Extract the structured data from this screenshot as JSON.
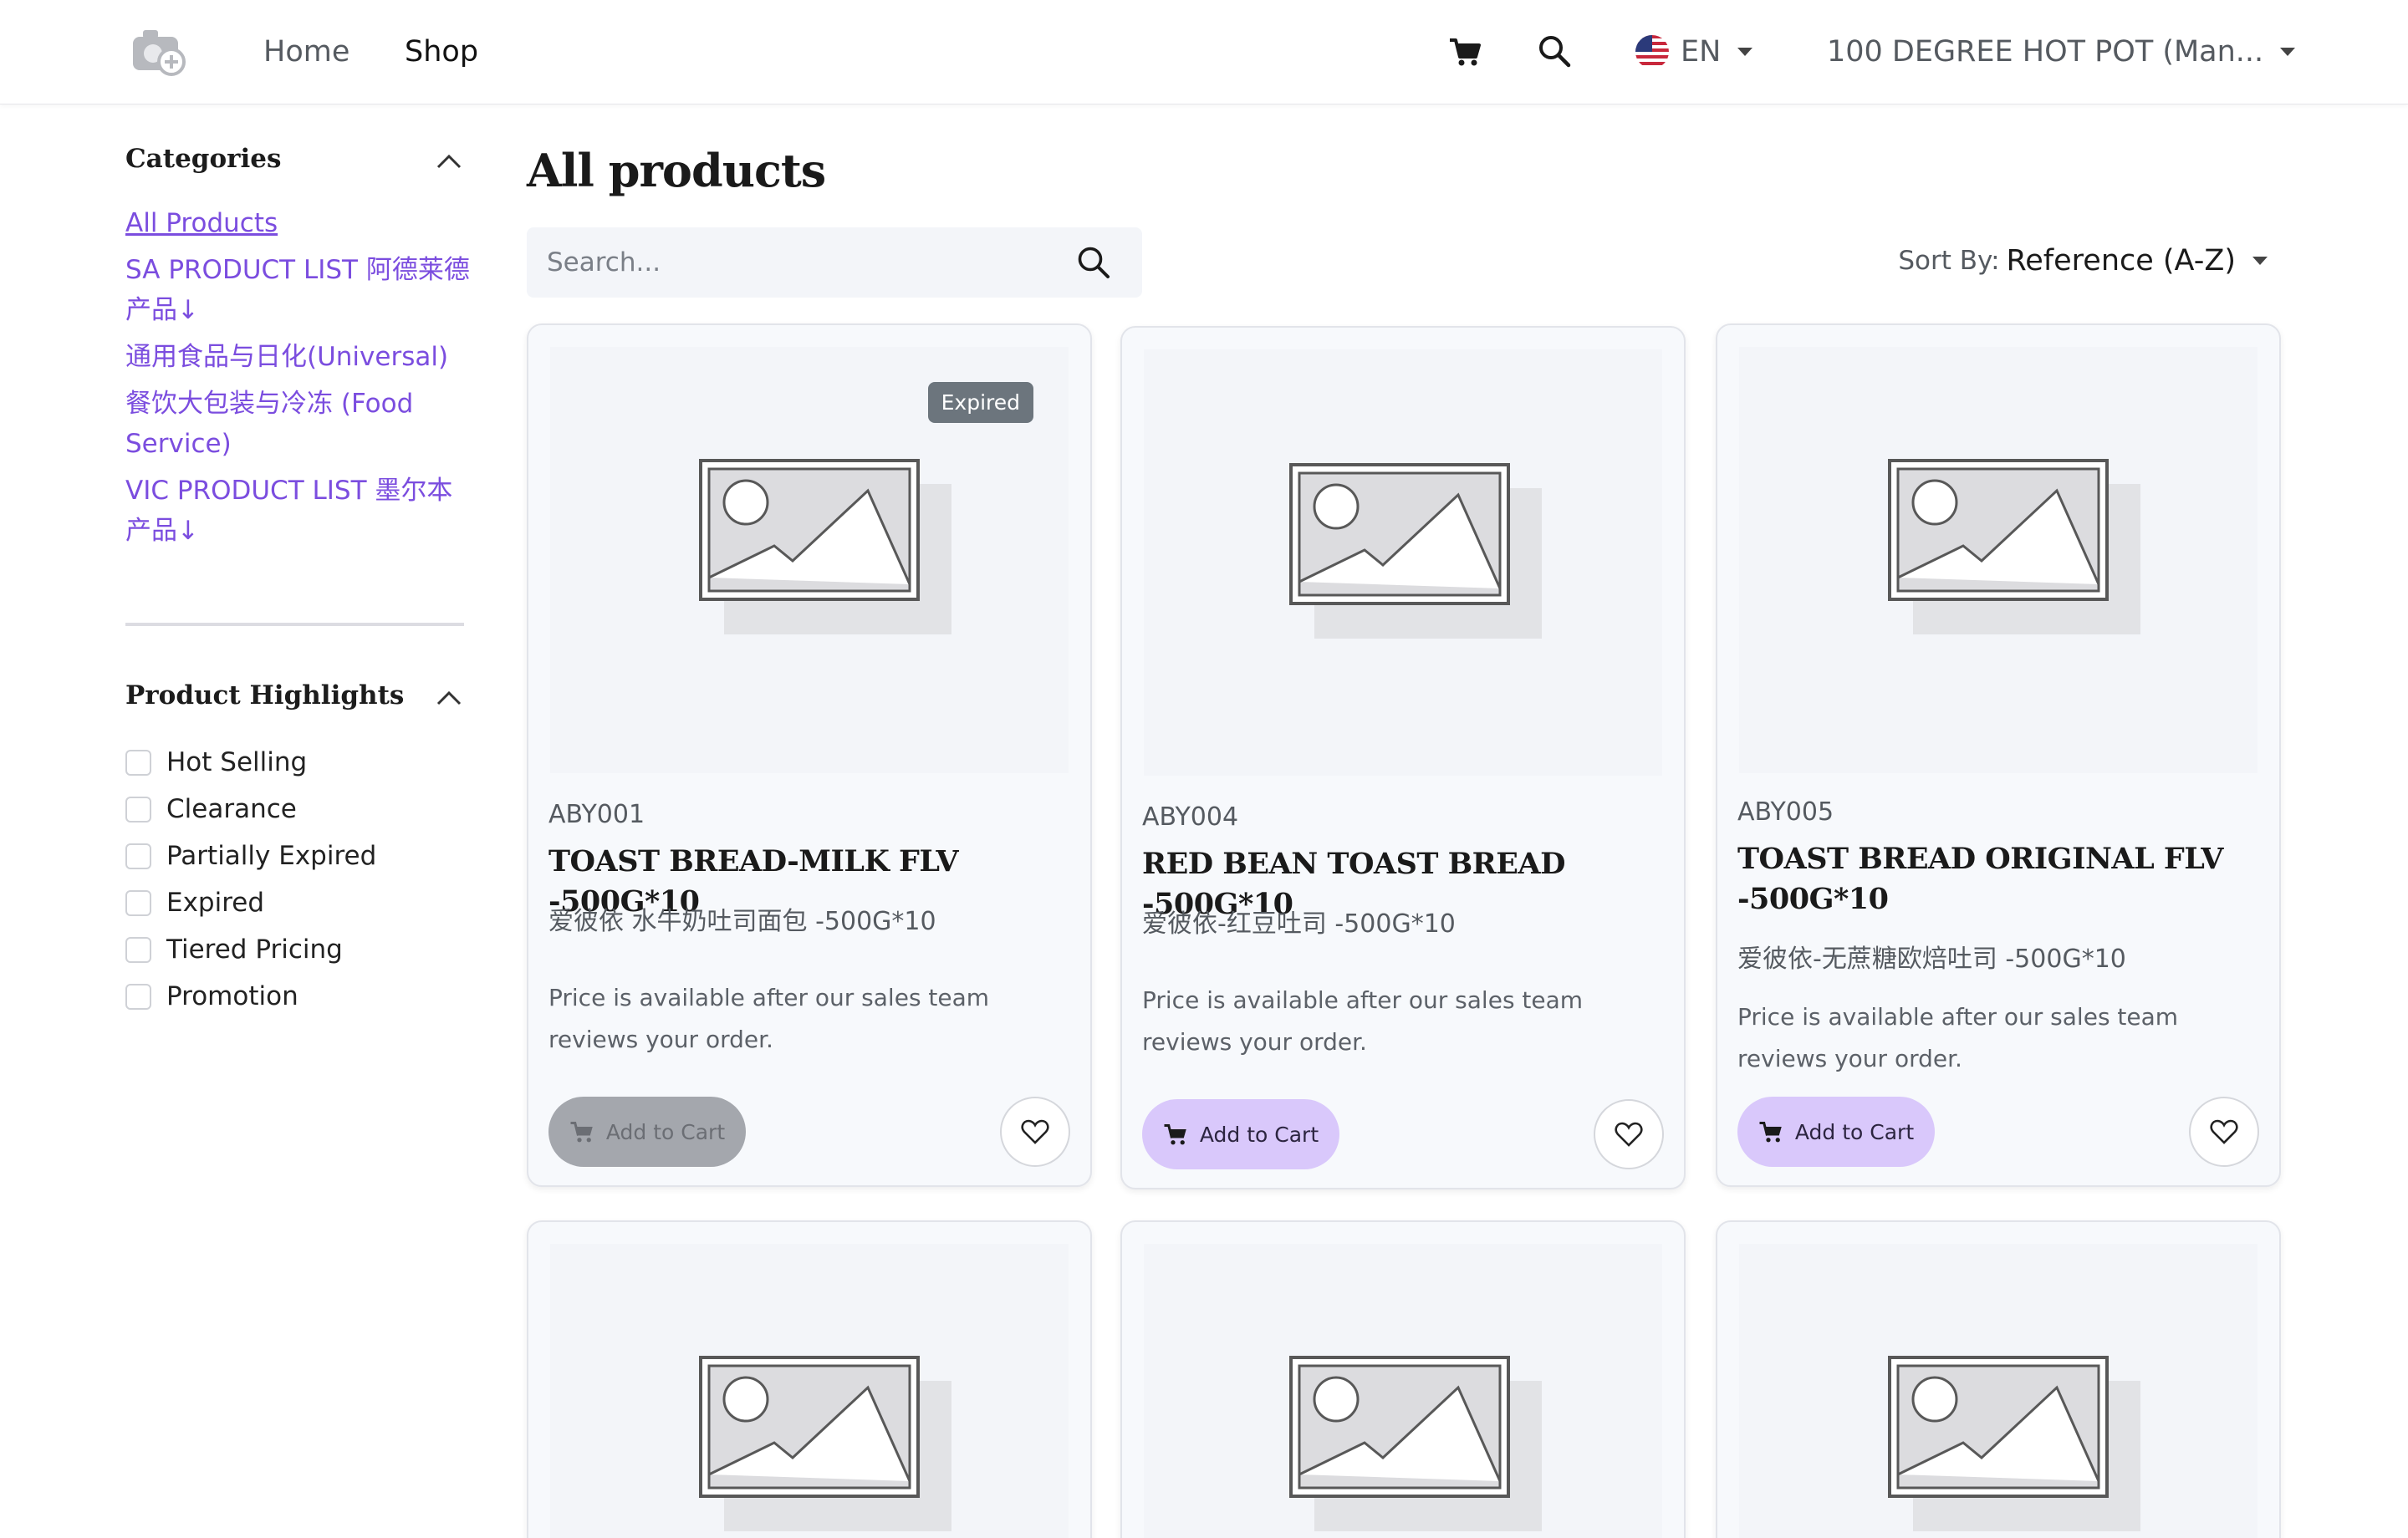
{
  "header": {
    "nav": [
      {
        "label": "Home"
      },
      {
        "label": "Shop"
      }
    ],
    "language": {
      "code": "EN",
      "flag": "us-flag"
    },
    "account": {
      "label": "100 DEGREE HOT POT (Man..."
    },
    "icons": {
      "logo": "camera-plus-icon",
      "cart": "cart-icon",
      "search": "search-icon"
    }
  },
  "sidebar": {
    "categories_title": "Categories",
    "categories": [
      {
        "label": "All Products",
        "active": true
      },
      {
        "label": "SA PRODUCT LIST 阿德莱德产品↓"
      },
      {
        "label": "通用食品与日化(Universal)"
      },
      {
        "label": "餐饮大包装与冷冻 (Food Service)"
      },
      {
        "label": "VIC PRODUCT LIST 墨尔本产品↓"
      }
    ],
    "highlights_title": "Product Highlights",
    "highlights": [
      {
        "label": "Hot Selling",
        "checked": false
      },
      {
        "label": "Clearance",
        "checked": false
      },
      {
        "label": "Partially Expired",
        "checked": false
      },
      {
        "label": "Expired",
        "checked": false
      },
      {
        "label": "Tiered Pricing",
        "checked": false
      },
      {
        "label": "Promotion",
        "checked": false
      }
    ]
  },
  "main": {
    "title": "All products",
    "search": {
      "placeholder": "Search..."
    },
    "sort": {
      "label": "Sort By:",
      "value": "Reference (A-Z)"
    },
    "products": [
      {
        "badge": "Expired",
        "ref": "ABY001",
        "name": "TOAST BREAD-MILK FLV -500G*10",
        "cn_name": "爱彼依 水牛奶吐司面包 -500G*10",
        "price_note": "Price is available after our sales team reviews your order.",
        "cart_label": "Add to Cart",
        "cart_disabled": true
      },
      {
        "ref": "ABY004",
        "name": "RED BEAN TOAST BREAD -500G*10",
        "cn_name": "爱彼依-红豆吐司 -500G*10",
        "price_note": "Price is available after our sales team reviews your order.",
        "cart_label": "Add to Cart",
        "cart_disabled": false
      },
      {
        "ref": "ABY005",
        "name": "TOAST BREAD ORIGINAL FLV -500G*10",
        "cn_name": "爱彼依-无蔗糖欧焙吐司 -500G*10",
        "price_note": "Price is available after our sales team reviews your order.",
        "cart_label": "Add to Cart",
        "cart_disabled": false
      }
    ]
  },
  "colors": {
    "accent_link": "#7b4ddf",
    "cart_button": "#d9c8fb",
    "cart_button_disabled": "#a4a7ad",
    "badge": "#6c757d"
  }
}
